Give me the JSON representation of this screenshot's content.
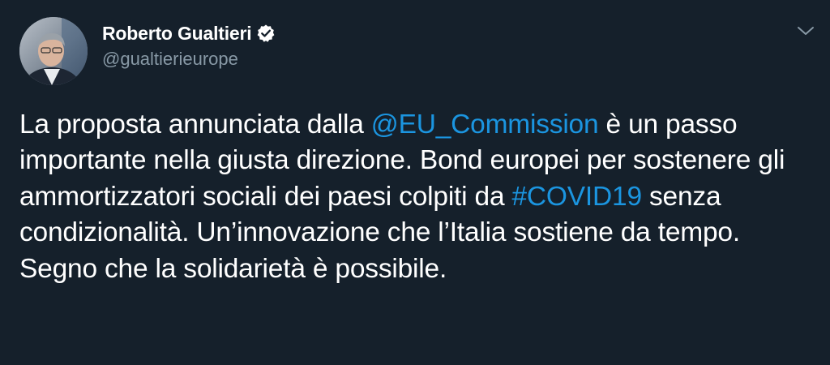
{
  "author": {
    "name": "Roberto Gualtieri",
    "handle": "@gualtierieurope",
    "avatar_icon": "profile-photo",
    "verified_icon": "verified-badge-icon"
  },
  "menu": {
    "icon": "chevron-down-icon"
  },
  "tweet": {
    "segments": [
      {
        "type": "text",
        "value": "La proposta annunciata dalla "
      },
      {
        "type": "mention",
        "value": "@EU_Commission"
      },
      {
        "type": "text",
        "value": " è un passo importante nella giusta direzione. Bond europei per sostenere gli ammortizzatori sociali dei paesi colpiti da "
      },
      {
        "type": "hashtag",
        "value": "#COVID19"
      },
      {
        "type": "text",
        "value": " senza condizionalità. Un’innovazione che l’Italia sostiene da tempo. Segno che la solidarietà è possibile."
      }
    ]
  },
  "colors": {
    "background": "#15202b",
    "text": "#ffffff",
    "secondary": "#8899a6",
    "link": "#1b95e0"
  }
}
